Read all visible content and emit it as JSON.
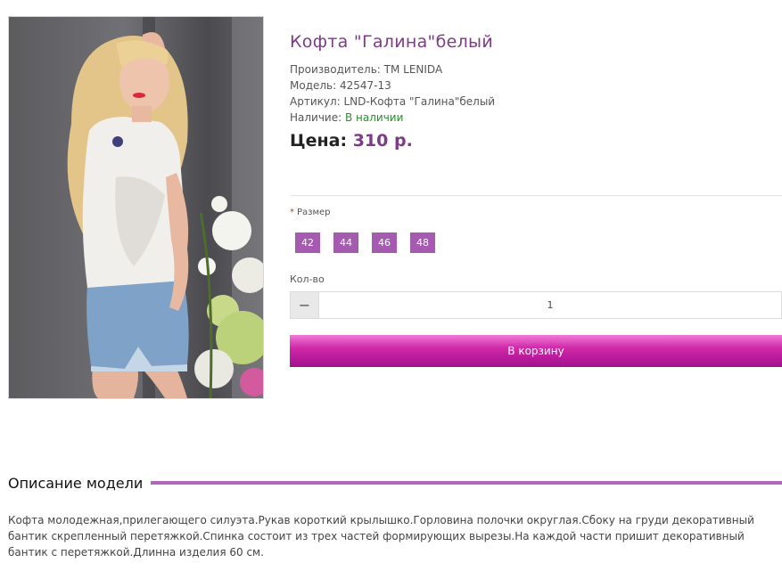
{
  "product": {
    "title": "Кофта \"Галина\"белый",
    "manufacturer": "Производитель: ТМ LENIDA",
    "model": "Модель: 42547-13",
    "sku": "Артикул: LND-Кофта \"Галина\"белый",
    "availability_label": "Наличие: ",
    "availability_value": "В наличии",
    "price_label": "Цена: ",
    "price_value": "310 р."
  },
  "options": {
    "required_mark": "*",
    "size_label": "Размер",
    "sizes": [
      "42",
      "44",
      "46",
      "48"
    ]
  },
  "quantity": {
    "label": "Кол-во",
    "minus_icon": "minus-icon",
    "value": "1"
  },
  "cart": {
    "button_label": "В корзину"
  },
  "description": {
    "heading": "Описание модели",
    "text": "Кофта молодежная,прилегающего силуэта.Рукав короткий крылышко.Горловина полочки округлая.Сбоку на груди декоративный бантик скрепленный перетяжкой.Спинка состоит из трех частей формирующих вырезы.На каждой части пришит декоративный бантик с перетяжкой.Длинна изделия 60 см."
  },
  "colors": {
    "accent": "#7d3a87",
    "size_button": "#a45bb0",
    "cart_button": "#c21ea3",
    "availability": "#2e8b2e"
  }
}
